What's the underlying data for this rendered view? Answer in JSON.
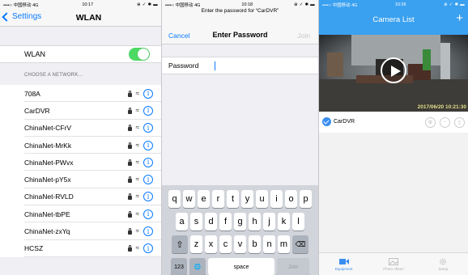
{
  "left_panel": {
    "status_bar": {
      "carrier": "••••○ 中国移动  4G",
      "time": "10:17",
      "right": "⊕ ✓ ✱ ▬"
    },
    "nav": {
      "back_label": "Settings",
      "title": "WLAN"
    },
    "wlan_label": "WLAN",
    "wlan_on": true,
    "section_header": "CHOOSE A NETWORK...",
    "networks": [
      "708A",
      "CarDVR",
      "ChinaNet-CFrV",
      "ChinaNet-MrKk",
      "ChinaNet-PWvx",
      "ChinaNet-pY5x",
      "ChinaNet-RVLD",
      "ChinaNet-tbPE",
      "ChinaNet-zxYq",
      "HCSZ"
    ]
  },
  "middle_panel": {
    "status_bar": {
      "carrier": "••••○ 中国移动  4G",
      "time": "10:18",
      "right": "⊕ ✓ ✱ ▬"
    },
    "prompt": "Enter the password for “CarDVR”",
    "cancel_label": "Cancel",
    "title": "Enter Password",
    "join_label": "Join",
    "password_label": "Password",
    "keyboard": {
      "row1": [
        "q",
        "w",
        "e",
        "r",
        "t",
        "y",
        "u",
        "i",
        "o",
        "p"
      ],
      "row2": [
        "a",
        "s",
        "d",
        "f",
        "g",
        "h",
        "j",
        "k",
        "l"
      ],
      "row3": [
        "z",
        "x",
        "c",
        "v",
        "b",
        "n",
        "m"
      ],
      "shift_key": "⇧",
      "delete_key": "⌫",
      "numbers_key": "123",
      "globe_key": "🌐",
      "space_label": "space",
      "join_key": "Join"
    }
  },
  "right_panel": {
    "status_bar": {
      "carrier": "••••○ 中国移动  4G",
      "time": "10:26",
      "right": "⊕ ✓ ✱ ▬"
    },
    "title": "Camera List",
    "add_label": "+",
    "timestamp": "2017/06/20 10:21:30",
    "device_name": "CarDVR",
    "tabs": [
      "Equipment",
      "Photo Album",
      "Setup"
    ],
    "accent": "#3aa0f0"
  }
}
